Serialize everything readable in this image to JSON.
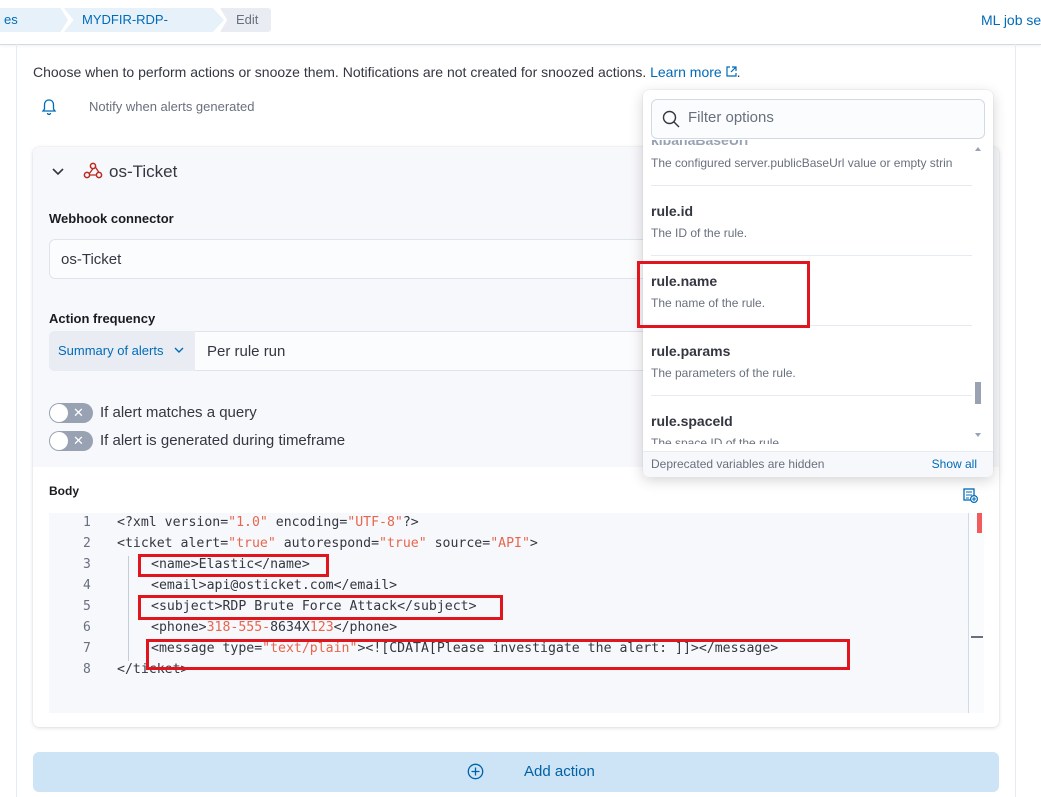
{
  "breadcrumbs": [
    "es (SIE...",
    "MYDFIR-RDP-Brute-...",
    "Edit"
  ],
  "header_link": "ML job se",
  "intro": {
    "text": "Choose when to perform actions or snooze them. Notifications are not created for snoozed actions.",
    "link": "Learn more",
    "trail": "."
  },
  "notify_label": "Notify when alerts generated",
  "action": {
    "title": "os-Ticket",
    "connector_label": "Webhook connector",
    "connector_value": "os-Ticket",
    "frequency_label": "Action frequency",
    "frequency_summary": "Summary of alerts",
    "frequency_value": "Per rule run",
    "toggle_query": "If alert matches a query",
    "toggle_timeframe": "If alert is generated during timeframe",
    "body_label": "Body"
  },
  "code": {
    "line_numbers": [
      "1",
      "2",
      "3",
      "4",
      "5",
      "6",
      "7",
      "8"
    ],
    "l1a": "<?xml version=",
    "l1b": "\"1.0\"",
    "l1c": " encoding=",
    "l1d": "\"UTF-8\"",
    "l1e": "?>",
    "l2a": "<ticket alert=",
    "l2b": "\"true\"",
    "l2c": " autorespond=",
    "l2d": "\"true\"",
    "l2e": " source=",
    "l2f": "\"API\"",
    "l2g": ">",
    "l3": "<name>Elastic</name>",
    "l4": "<email>api@osticket.com</email>",
    "l5": "<subject>RDP Brute Force Attack</subject>",
    "l6a": "<phone>",
    "l6b": "318-555-",
    "l6c": "8634X",
    "l6d": "123",
    "l6e": "</phone>",
    "l7a": "<message type=",
    "l7b": "\"text/plain\"",
    "l7c": "><![CDATA[Please investigate the alert: ]]></message>",
    "l8": "</ticket>"
  },
  "popover": {
    "filter_placeholder": "Filter options",
    "cut_title": "kibanaBaseUrl",
    "cut_desc": "The configured server.publicBaseUrl value or empty strin",
    "options": [
      {
        "title": "rule.id",
        "desc": "The ID of the rule."
      },
      {
        "title": "rule.name",
        "desc": "The name of the rule."
      },
      {
        "title": "rule.params",
        "desc": "The parameters of the rule."
      },
      {
        "title": "rule.spaceId",
        "desc": "The space ID of the rule."
      }
    ],
    "footer_note": "Deprecated variables are hidden",
    "footer_link": "Show all"
  },
  "add_action_label": "Add action",
  "colors": {
    "link": "#006bb8",
    "highlight": "#e0151e",
    "string": "#e7664c",
    "button": "#cce4f5"
  }
}
